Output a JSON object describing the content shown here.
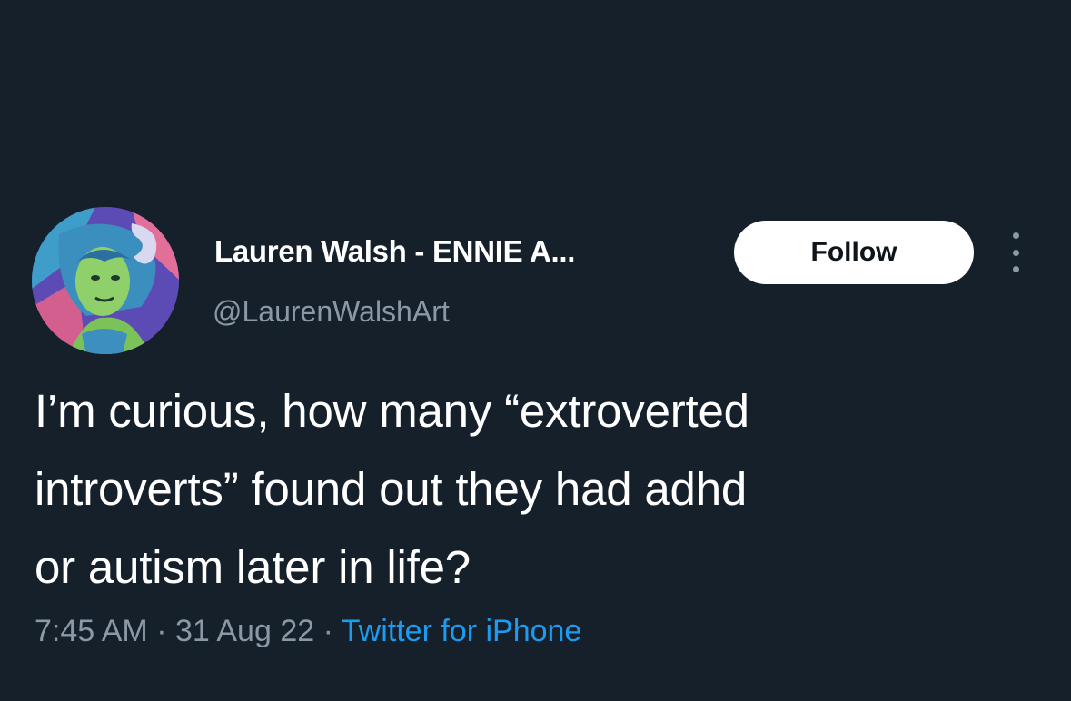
{
  "tweet": {
    "author": {
      "display_name": "Lauren Walsh - ENNIE A...",
      "handle": "@LaurenWalshArt",
      "avatar_icon": "illustrated-avatar"
    },
    "follow_label": "Follow",
    "more_icon": "more-dots-icon",
    "text_lines": [
      "I’m curious, how many “extroverted",
      "introverts” found out they had adhd",
      "or autism later in life?"
    ],
    "time": "7:45 AM",
    "separator": "·",
    "date": "31 Aug 22",
    "source": "Twitter for iPhone"
  },
  "colors": {
    "background": "#15202b",
    "text_primary": "#ffffff",
    "text_secondary": "#8b98a5",
    "link": "#1d9bf0",
    "follow_bg": "#ffffff"
  }
}
